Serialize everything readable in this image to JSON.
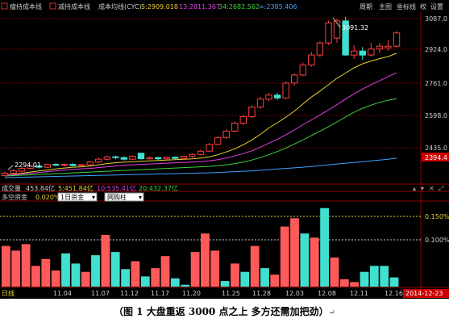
{
  "toolbar": {
    "items": [
      "瘤持成本线",
      "减持成本线",
      "成本均线(CYC)"
    ],
    "values": [
      {
        "text": "5:2909.018",
        "color": "#e8d030"
      },
      {
        "text": "13:2811.367",
        "color": "#e040e0"
      },
      {
        "text": "34:2682.562",
        "color": "#40d040"
      },
      {
        "text": "∞:2385.406",
        "color": "#40a0ff"
      }
    ],
    "right": [
      "周期",
      "主图",
      "坐标线",
      "权",
      "设置"
    ]
  },
  "main": {
    "price_labels": [
      "3087.0",
      "2924.0",
      "2761.0",
      "2598.0",
      "2435.0",
      "2394.4"
    ],
    "high_annotation": "3091.32",
    "low_annotation": "2294.01"
  },
  "volume": {
    "label": "成交量",
    "value": "453.84亿",
    "ma5": "5:451.84亿",
    "ma10": "10:535.41亿",
    "ma20": "20:432.37亿"
  },
  "indicator": {
    "label": "多空资金",
    "value": "0.020%",
    "select1": "1日资金",
    "select2": "网购柱",
    "levels": [
      "0.150%",
      "0.100%"
    ]
  },
  "x_axis": {
    "left_label": "日线",
    "ticks": [
      "11.04",
      "11.07",
      "11.12",
      "11.17",
      "11.20",
      "11.25",
      "11.28",
      "12.03",
      "12.08",
      "12.11",
      "12.16"
    ],
    "date_badge": "2014-12-23"
  },
  "colors": {
    "up": "#ff4040",
    "down": "#40e0d0",
    "panel_bg": "#000000",
    "grid": "#800000"
  },
  "caption": {
    "text": "（图 1  大盘重返 3000 点之上  多方还需加把劲）",
    "mark": "↵"
  },
  "chart_data": {
    "type": "candlestick",
    "ylim": [
      2280,
      3110
    ],
    "candles": [
      {
        "o": 2298,
        "c": 2310,
        "h": 2318,
        "l": 2294
      },
      {
        "o": 2310,
        "c": 2322,
        "h": 2330,
        "l": 2305
      },
      {
        "o": 2320,
        "c": 2334,
        "h": 2340,
        "l": 2315
      },
      {
        "o": 2334,
        "c": 2346,
        "h": 2352,
        "l": 2330
      },
      {
        "o": 2346,
        "c": 2340,
        "h": 2352,
        "l": 2334
      },
      {
        "o": 2340,
        "c": 2354,
        "h": 2358,
        "l": 2336
      },
      {
        "o": 2354,
        "c": 2350,
        "h": 2360,
        "l": 2344
      },
      {
        "o": 2350,
        "c": 2354,
        "h": 2358,
        "l": 2344
      },
      {
        "o": 2354,
        "c": 2348,
        "h": 2360,
        "l": 2344
      },
      {
        "o": 2348,
        "c": 2352,
        "h": 2356,
        "l": 2342
      },
      {
        "o": 2352,
        "c": 2366,
        "h": 2372,
        "l": 2348
      },
      {
        "o": 2366,
        "c": 2380,
        "h": 2388,
        "l": 2360
      },
      {
        "o": 2380,
        "c": 2392,
        "h": 2398,
        "l": 2374
      },
      {
        "o": 2392,
        "c": 2388,
        "h": 2398,
        "l": 2380
      },
      {
        "o": 2388,
        "c": 2380,
        "h": 2394,
        "l": 2374
      },
      {
        "o": 2380,
        "c": 2394,
        "h": 2400,
        "l": 2376
      },
      {
        "o": 2410,
        "c": 2382,
        "h": 2412,
        "l": 2378
      },
      {
        "o": 2382,
        "c": 2388,
        "h": 2394,
        "l": 2378
      },
      {
        "o": 2388,
        "c": 2382,
        "h": 2392,
        "l": 2376
      },
      {
        "o": 2382,
        "c": 2390,
        "h": 2394,
        "l": 2378
      },
      {
        "o": 2390,
        "c": 2384,
        "h": 2394,
        "l": 2378
      },
      {
        "o": 2384,
        "c": 2394,
        "h": 2398,
        "l": 2380
      },
      {
        "o": 2394,
        "c": 2404,
        "h": 2410,
        "l": 2388
      },
      {
        "o": 2404,
        "c": 2420,
        "h": 2426,
        "l": 2398
      },
      {
        "o": 2420,
        "c": 2454,
        "h": 2460,
        "l": 2416
      },
      {
        "o": 2454,
        "c": 2488,
        "h": 2494,
        "l": 2450
      },
      {
        "o": 2488,
        "c": 2520,
        "h": 2528,
        "l": 2482
      },
      {
        "o": 2520,
        "c": 2560,
        "h": 2568,
        "l": 2514
      },
      {
        "o": 2560,
        "c": 2592,
        "h": 2600,
        "l": 2552
      },
      {
        "o": 2592,
        "c": 2640,
        "h": 2648,
        "l": 2586
      },
      {
        "o": 2640,
        "c": 2680,
        "h": 2692,
        "l": 2632
      },
      {
        "o": 2680,
        "c": 2700,
        "h": 2710,
        "l": 2668
      },
      {
        "o": 2700,
        "c": 2686,
        "h": 2712,
        "l": 2676
      },
      {
        "o": 2686,
        "c": 2760,
        "h": 2768,
        "l": 2680
      },
      {
        "o": 2760,
        "c": 2800,
        "h": 2808,
        "l": 2748
      },
      {
        "o": 2800,
        "c": 2850,
        "h": 2862,
        "l": 2794
      },
      {
        "o": 2850,
        "c": 2900,
        "h": 2916,
        "l": 2842
      },
      {
        "o": 2900,
        "c": 2960,
        "h": 2968,
        "l": 2890
      },
      {
        "o": 2960,
        "c": 3060,
        "h": 3072,
        "l": 2950
      },
      {
        "o": 2984,
        "c": 3070,
        "h": 3080,
        "l": 2960
      },
      {
        "o": 3070,
        "c": 2900,
        "h": 3091,
        "l": 2896
      },
      {
        "o": 2900,
        "c": 2920,
        "h": 2950,
        "l": 2880
      },
      {
        "o": 2920,
        "c": 2900,
        "h": 2940,
        "l": 2876
      },
      {
        "o": 2900,
        "c": 2930,
        "h": 2960,
        "l": 2892
      },
      {
        "o": 2930,
        "c": 2944,
        "h": 2960,
        "l": 2910
      },
      {
        "o": 2936,
        "c": 2944,
        "h": 2976,
        "l": 2920
      },
      {
        "o": 2944,
        "c": 3010,
        "h": 3020,
        "l": 2936
      }
    ],
    "lines": [
      {
        "name": "5",
        "color": "#e8d030",
        "values": [
          2300,
          2304,
          2310,
          2316,
          2322,
          2326,
          2332,
          2336,
          2340,
          2342,
          2346,
          2352,
          2358,
          2362,
          2366,
          2368,
          2370,
          2372,
          2374,
          2376,
          2378,
          2380,
          2382,
          2386,
          2392,
          2402,
          2416,
          2432,
          2452,
          2476,
          2504,
          2536,
          2562,
          2590,
          2620,
          2656,
          2690,
          2720,
          2752,
          2784,
          2810,
          2836,
          2856,
          2870,
          2882,
          2892,
          2909
        ]
      },
      {
        "name": "13",
        "color": "#e040e0",
        "values": [
          2300,
          2302,
          2306,
          2310,
          2314,
          2318,
          2322,
          2326,
          2330,
          2332,
          2334,
          2338,
          2342,
          2346,
          2350,
          2352,
          2354,
          2356,
          2358,
          2360,
          2362,
          2364,
          2366,
          2368,
          2372,
          2378,
          2386,
          2396,
          2408,
          2422,
          2440,
          2460,
          2480,
          2502,
          2526,
          2552,
          2576,
          2600,
          2626,
          2652,
          2680,
          2706,
          2730,
          2752,
          2772,
          2792,
          2811
        ]
      },
      {
        "name": "34",
        "color": "#40d040",
        "values": [
          2296,
          2298,
          2300,
          2302,
          2304,
          2306,
          2308,
          2310,
          2312,
          2314,
          2316,
          2318,
          2320,
          2322,
          2324,
          2326,
          2328,
          2330,
          2332,
          2334,
          2336,
          2338,
          2340,
          2342,
          2344,
          2348,
          2352,
          2358,
          2366,
          2376,
          2388,
          2402,
          2418,
          2436,
          2456,
          2476,
          2498,
          2520,
          2542,
          2566,
          2590,
          2614,
          2634,
          2650,
          2664,
          2674,
          2682
        ]
      },
      {
        "name": "∞",
        "color": "#40a0ff",
        "values": [
          2288,
          2289,
          2290,
          2291,
          2292,
          2293,
          2294,
          2295,
          2296,
          2297,
          2298,
          2299,
          2300,
          2301,
          2302,
          2303,
          2304,
          2305,
          2306,
          2307,
          2308,
          2309,
          2310,
          2311,
          2312,
          2314,
          2316,
          2318,
          2320,
          2322,
          2325,
          2328,
          2331,
          2334,
          2337,
          2340,
          2344,
          2348,
          2352,
          2356,
          2360,
          2364,
          2368,
          2372,
          2376,
          2380,
          2385
        ]
      }
    ],
    "bars": [
      {
        "v": 0.088,
        "d": "up"
      },
      {
        "v": 0.078,
        "d": "up"
      },
      {
        "v": 0.092,
        "d": "up"
      },
      {
        "v": 0.045,
        "d": "up"
      },
      {
        "v": 0.06,
        "d": "up"
      },
      {
        "v": 0.035,
        "d": "up"
      },
      {
        "v": 0.072,
        "d": "down"
      },
      {
        "v": 0.05,
        "d": "down"
      },
      {
        "v": 0.032,
        "d": "up"
      },
      {
        "v": 0.068,
        "d": "down"
      },
      {
        "v": 0.112,
        "d": "up"
      },
      {
        "v": 0.075,
        "d": "down"
      },
      {
        "v": 0.038,
        "d": "down"
      },
      {
        "v": 0.055,
        "d": "up"
      },
      {
        "v": 0.022,
        "d": "down"
      },
      {
        "v": 0.04,
        "d": "up"
      },
      {
        "v": 0.066,
        "d": "up"
      },
      {
        "v": 0.018,
        "d": "down"
      },
      {
        "v": 0.004,
        "d": "down"
      },
      {
        "v": 0.075,
        "d": "up"
      },
      {
        "v": 0.115,
        "d": "up"
      },
      {
        "v": 0.078,
        "d": "up"
      },
      {
        "v": 0.012,
        "d": "down"
      },
      {
        "v": 0.05,
        "d": "up"
      },
      {
        "v": 0.032,
        "d": "down"
      },
      {
        "v": 0.088,
        "d": "up"
      },
      {
        "v": 0.04,
        "d": "down"
      },
      {
        "v": 0.026,
        "d": "up"
      },
      {
        "v": 0.13,
        "d": "up"
      },
      {
        "v": 0.148,
        "d": "up"
      },
      {
        "v": 0.115,
        "d": "down"
      },
      {
        "v": 0.106,
        "d": "up"
      },
      {
        "v": 0.17,
        "d": "down"
      },
      {
        "v": 0.063,
        "d": "up"
      },
      {
        "v": 0.016,
        "d": "up"
      },
      {
        "v": 0.01,
        "d": "up"
      },
      {
        "v": 0.032,
        "d": "down"
      },
      {
        "v": 0.045,
        "d": "down"
      },
      {
        "v": 0.045,
        "d": "down"
      },
      {
        "v": 0.02,
        "d": "down"
      }
    ],
    "bar_ylim": [
      0,
      0.18
    ]
  }
}
